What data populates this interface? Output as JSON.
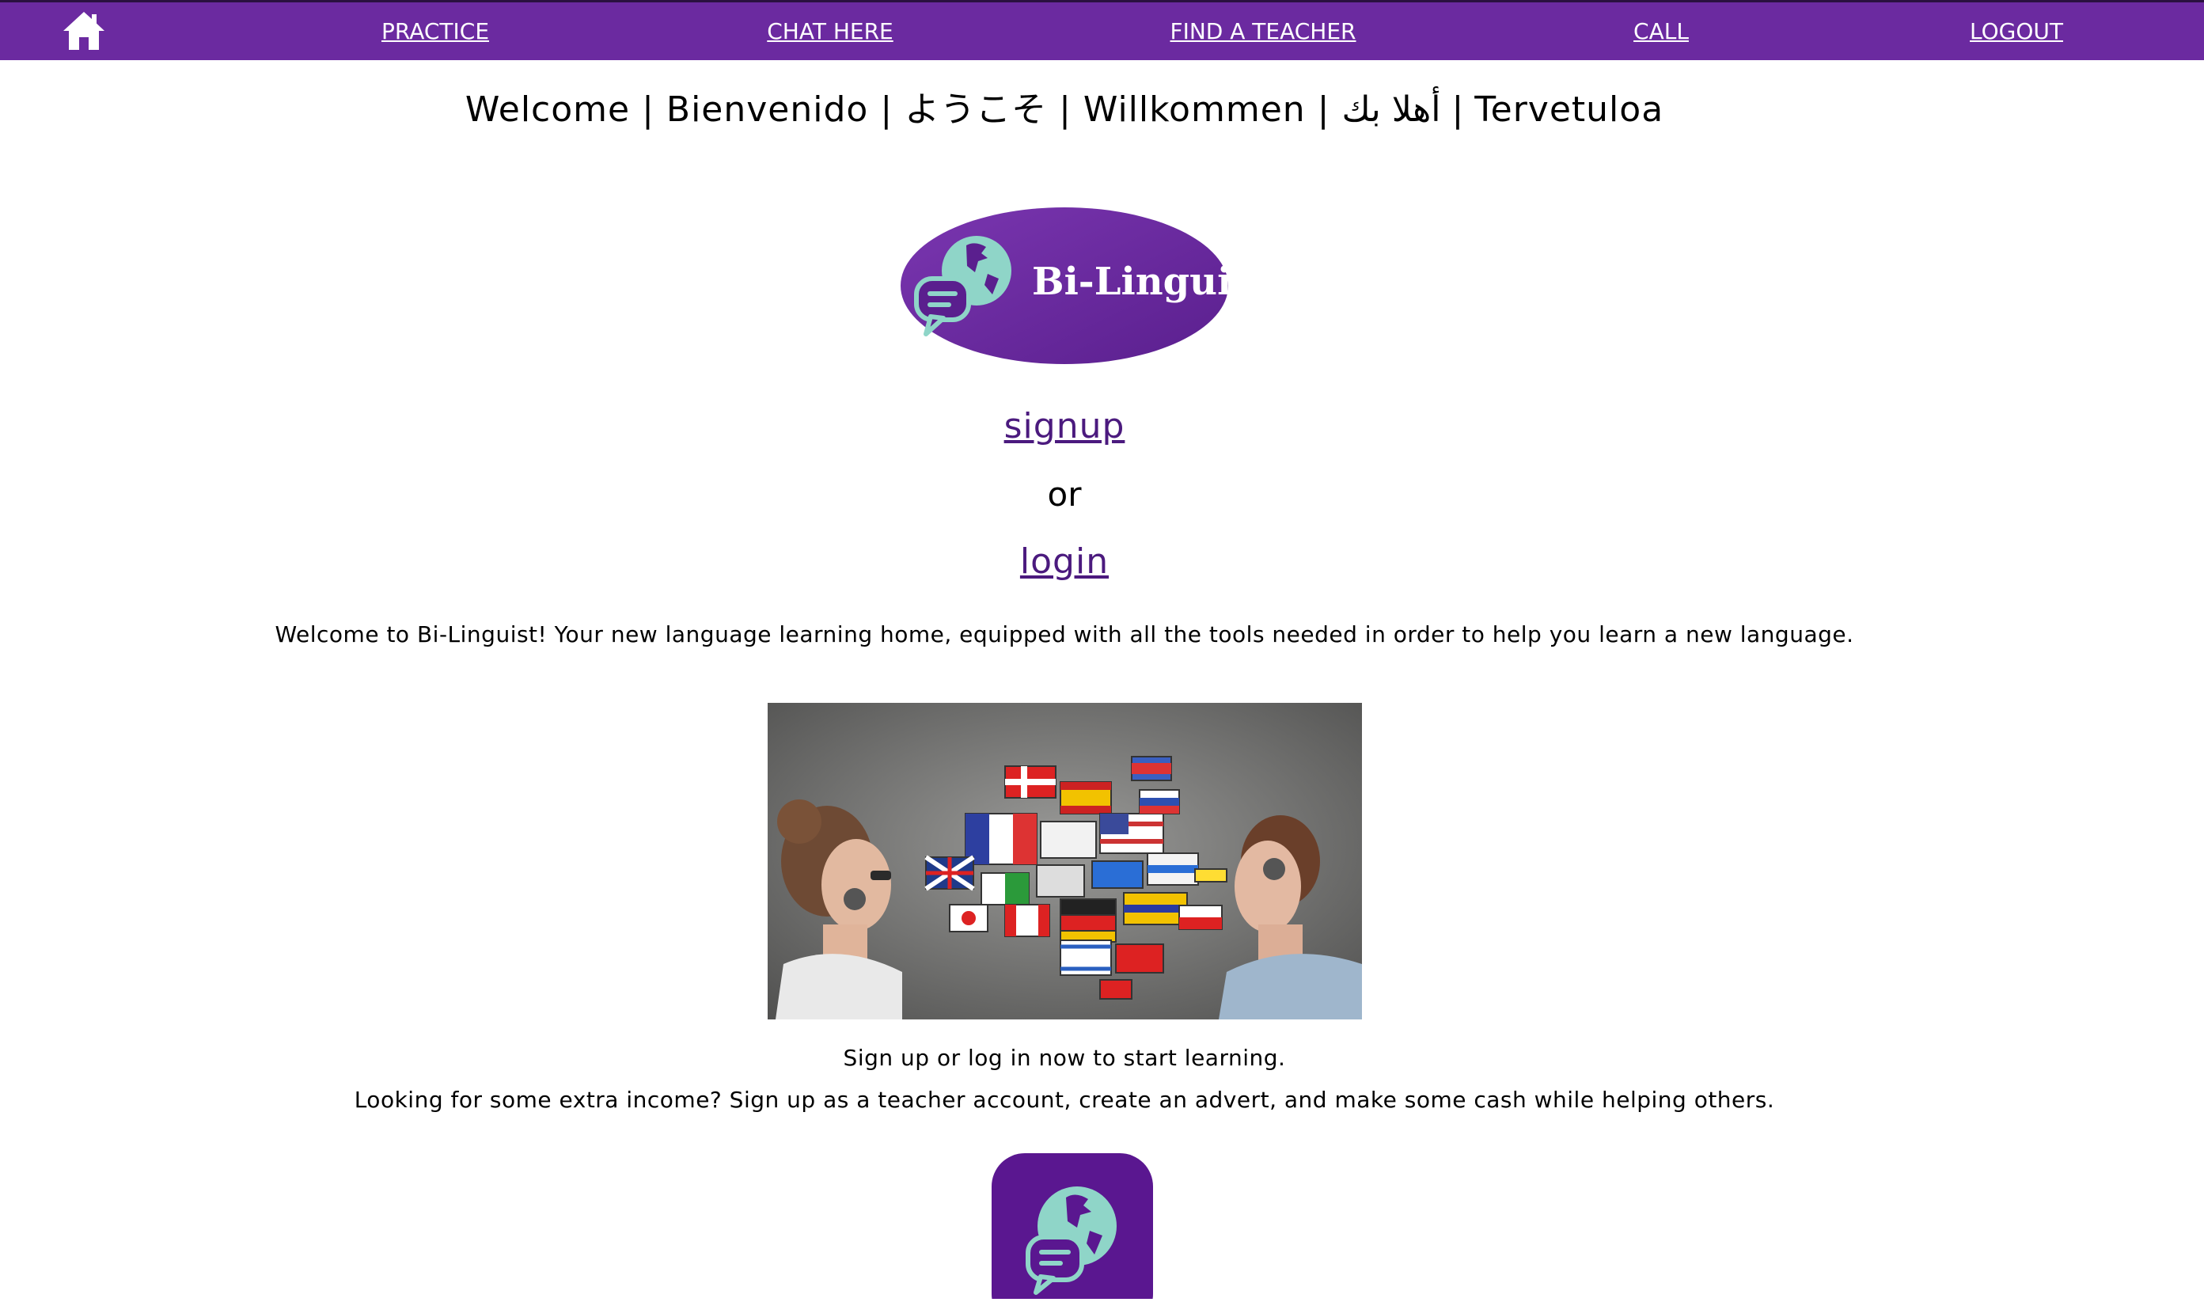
{
  "nav": {
    "home_icon": "home-icon",
    "items": [
      {
        "label": "PRACTICE"
      },
      {
        "label": "CHAT HERE"
      },
      {
        "label": "FIND A TEACHER"
      },
      {
        "label": "CALL"
      },
      {
        "label": "LOGOUT"
      }
    ]
  },
  "header": {
    "welcome": "Welcome | Bienvenido | ようこそ | Willkommen | أهلا بك | Tervetuloa"
  },
  "logo": {
    "text": "Bi-Linguist"
  },
  "auth": {
    "signup_label": "signup",
    "or_label": "or",
    "login_label": "login"
  },
  "content": {
    "intro": "Welcome to Bi-Linguist! Your new language learning home, equipped with all the tools needed in order to help you learn a new language.",
    "cta": "Sign up or log in now to start learning.",
    "teacher_pitch": "Looking for some extra income? Sign up as a teacher account, create an advert, and make some cash while helping others."
  },
  "colors": {
    "brand_purple": "#6b2aa0",
    "link_purple": "#4b1a7e",
    "logo_teal": "#8fd5c8"
  }
}
